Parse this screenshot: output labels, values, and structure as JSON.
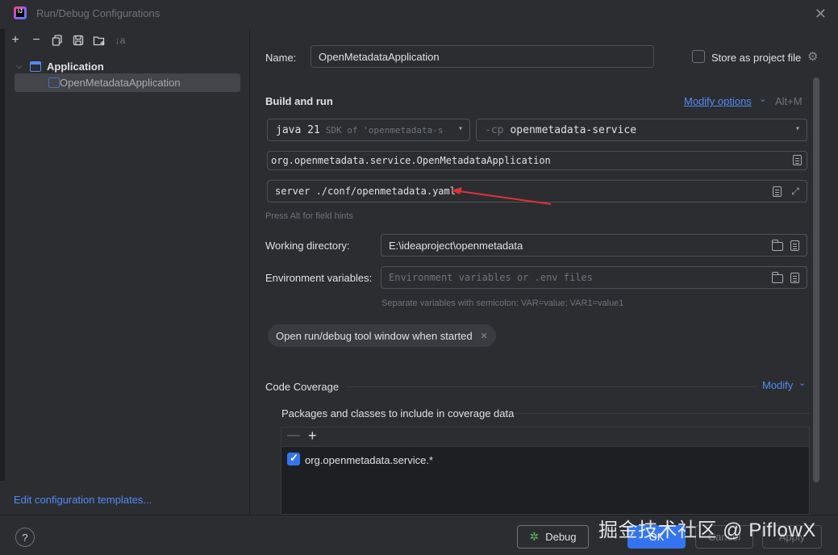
{
  "window": {
    "title": "Run/Debug Configurations"
  },
  "left": {
    "tree_root": "Application",
    "tree_child": "OpenMetadataApplication",
    "edit_templates": "Edit configuration templates..."
  },
  "form": {
    "name_label": "Name:",
    "name_value": "OpenMetadataApplication",
    "store_label": "Store as project file",
    "build_run": "Build and run",
    "modify_options": "Modify options",
    "shortcut": "Alt+M",
    "jdk_main": "java 21",
    "jdk_detail": "SDK of 'openmetadata-s",
    "cp_prefix": "-cp",
    "cp_value": "openmetadata-service",
    "main_class": "org.openmetadata.service.OpenMetadataApplication",
    "program_args": "server ./conf/openmetadata.yaml",
    "field_hint": "Press Alt for field hints",
    "workdir_label": "Working directory:",
    "workdir_value": "E:\\ideaproject\\openmetadata",
    "env_label": "Environment variables:",
    "env_placeholder": "Environment variables or .env files",
    "env_hint": "Separate variables with semicolon: VAR=value; VAR1=value1",
    "chip_label": "Open run/debug tool window when started",
    "coverage_title": "Code Coverage",
    "coverage_modify": "Modify",
    "packages_label": "Packages and classes to include in coverage data",
    "package_item": "org.openmetadata.service.*"
  },
  "buttons": {
    "help": "?",
    "debug": "Debug",
    "ok": "OK",
    "cancel": "Cancel",
    "apply": "Apply"
  },
  "watermark": "掘金技术社区 @ PiflowX",
  "colors": {
    "accent": "#3574f0",
    "link": "#548af7",
    "arrow": "#e0313c"
  }
}
